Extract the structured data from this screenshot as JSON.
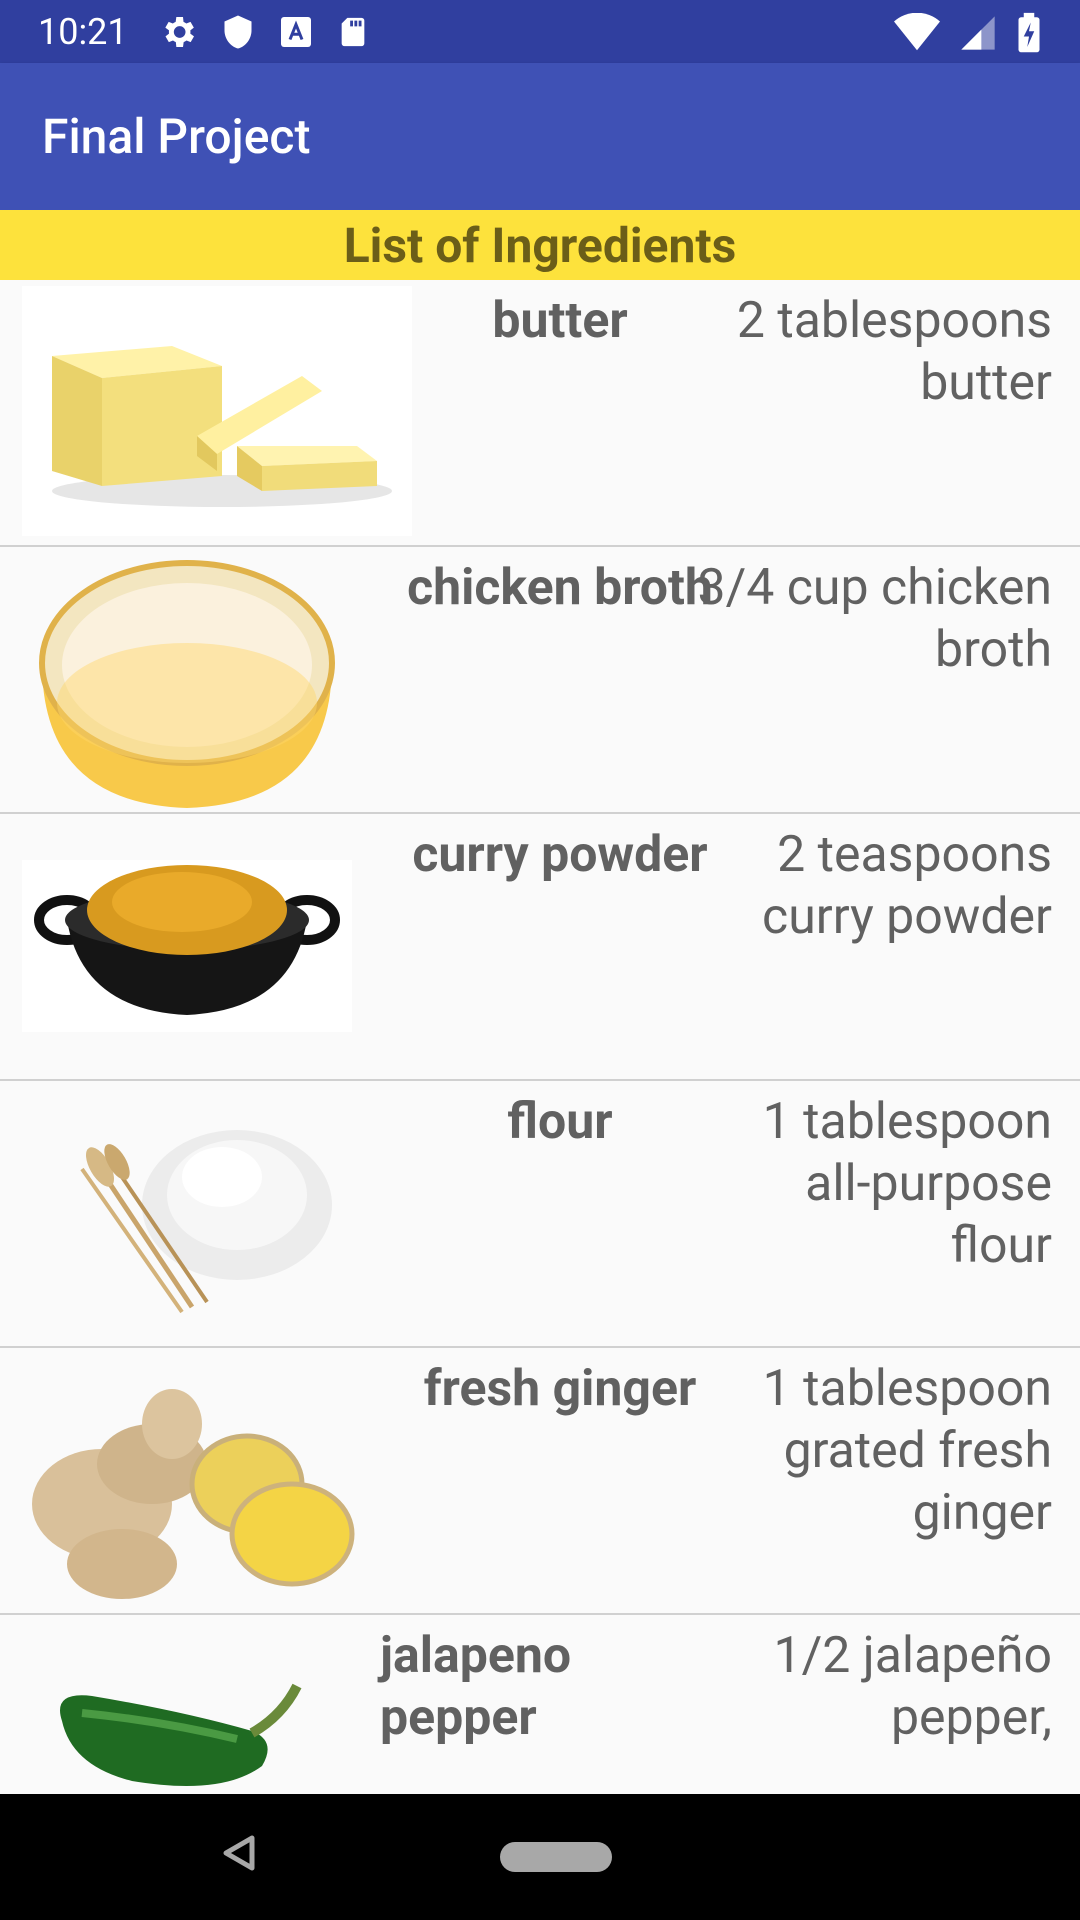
{
  "status_bar": {
    "time": "10:21",
    "icons_left": [
      "settings-icon",
      "shield-icon",
      "font-icon",
      "sd-card-icon"
    ],
    "icons_right": [
      "wifi-icon",
      "signal-icon",
      "battery-icon"
    ]
  },
  "app_bar": {
    "title": "Final Project"
  },
  "header": {
    "title": "List of Ingredients"
  },
  "ingredients": [
    {
      "name": "butter",
      "quantity": "2 tablespoons butter",
      "image": "butter-image"
    },
    {
      "name": "chicken broth",
      "quantity": "3/4 cup chicken broth",
      "image": "chicken-broth-image"
    },
    {
      "name": "curry powder",
      "quantity": "2 teaspoons curry powder",
      "image": "curry-powder-image"
    },
    {
      "name": "flour",
      "quantity": "1 tablespoon all-purpose flour",
      "image": "flour-image"
    },
    {
      "name": "fresh ginger",
      "quantity": "1 tablespoon grated fresh ginger",
      "image": "ginger-image"
    },
    {
      "name": "jalapeno pepper",
      "quantity": "1/2 jalapeño pepper,",
      "image": "jalapeno-image"
    }
  ],
  "nav_bar": {
    "buttons": [
      "back-button",
      "home-button"
    ]
  }
}
